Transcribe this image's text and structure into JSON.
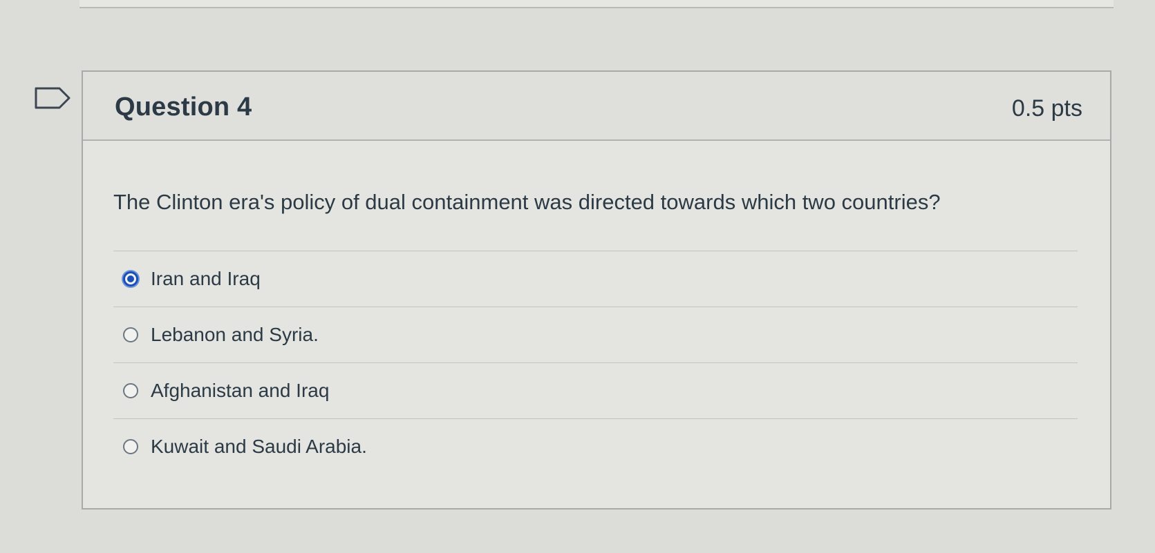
{
  "question": {
    "title": "Question 4",
    "points": "0.5 pts",
    "text": "The Clinton era's policy of dual containment was directed towards which two countries?"
  },
  "answers": [
    {
      "label": "Iran and Iraq",
      "selected": true
    },
    {
      "label": "Lebanon and Syria.",
      "selected": false
    },
    {
      "label": "Afghanistan and Iraq",
      "selected": false
    },
    {
      "label": "Kuwait and Saudi Arabia.",
      "selected": false
    }
  ],
  "colors": {
    "accent": "#1b4fb8",
    "text": "#2b3a44",
    "border": "#a9aaa8"
  },
  "icons": {
    "bookmark": "bookmark-icon",
    "radio": "radio-icon"
  }
}
